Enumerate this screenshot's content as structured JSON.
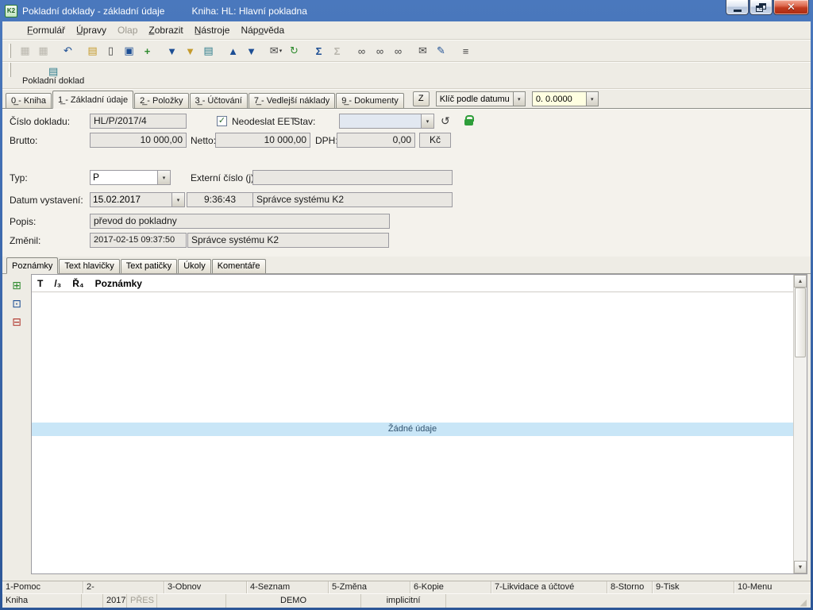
{
  "glyphs": {
    "dropdown": "▾",
    "check": "✓",
    "close": "✕",
    "scroll_up": "▲",
    "scroll_down": "▼",
    "history": "↺",
    "resize": "◢"
  },
  "window": {
    "icon_text": "K2",
    "title": "Pokladní doklady - základní údaje",
    "subtitle": "Kniha: HL: Hlavní pokladna"
  },
  "menu": {
    "items": [
      {
        "label": "F̲ormulář"
      },
      {
        "label": "Ú̲pravy"
      },
      {
        "label": "Olap"
      },
      {
        "label": "Z̲obrazit"
      },
      {
        "label": "N̲ástroje"
      },
      {
        "label": "Nápo̲věda"
      }
    ]
  },
  "toolbar": {
    "buttons": [
      {
        "name": "save",
        "glyph": "▦"
      },
      {
        "name": "save-record",
        "glyph": "▦"
      },
      {
        "name": "undo",
        "glyph": "↶"
      },
      {
        "name": "open",
        "glyph": "▤"
      },
      {
        "name": "new-document",
        "glyph": "▯"
      },
      {
        "name": "copy-document",
        "glyph": "▣"
      },
      {
        "name": "insert-record",
        "glyph": "+"
      },
      {
        "name": "filter",
        "glyph": "▼"
      },
      {
        "name": "filter-settings",
        "glyph": "▼"
      },
      {
        "name": "books",
        "glyph": "▤"
      },
      {
        "name": "previous-record",
        "glyph": "▲"
      },
      {
        "name": "next-record",
        "glyph": "▼"
      },
      {
        "name": "mail-menu",
        "glyph": "✉"
      },
      {
        "name": "actions",
        "glyph": "↻"
      },
      {
        "name": "sum",
        "glyph": "Σ"
      },
      {
        "name": "sum-selection",
        "glyph": "Σ"
      },
      {
        "name": "search",
        "glyph": "∞"
      },
      {
        "name": "search-next",
        "glyph": "∞"
      },
      {
        "name": "search-fulltext",
        "glyph": "∞"
      },
      {
        "name": "send-message",
        "glyph": "✉"
      },
      {
        "name": "edit-text",
        "glyph": "✎"
      },
      {
        "name": "column-settings",
        "glyph": "≡"
      }
    ]
  },
  "toolbar2": {
    "icon_glyph": "▤",
    "label": "Pokladní doklad"
  },
  "tabs": {
    "items": [
      {
        "label": "0̲ - Kniha"
      },
      {
        "label": "1̲ - Základní údaje"
      },
      {
        "label": "2̲ - Položky"
      },
      {
        "label": "3̲ - Účtování"
      },
      {
        "label": "7̲ - Vedlejší náklady"
      },
      {
        "label": "9̲ - Dokumenty"
      }
    ],
    "z_button": "Z",
    "sort_key": "Klíč podle datumu",
    "rate": "0. 0.0000"
  },
  "form": {
    "labels": {
      "doc_number": "Číslo dokladu:",
      "eet": "Neodeslat EET",
      "status": "Stav:",
      "brutto": "Brutto:",
      "netto": "Netto:",
      "dph": "DPH:",
      "type": "Typ:",
      "external": "Externí číslo (j):",
      "issue_date": "Datum vystavení:",
      "description": "Popis:",
      "changed": "Změnil:"
    },
    "values": {
      "doc_number": "HL/P/2017/4",
      "status": "",
      "brutto": "10 000,00",
      "netto": "10 000,00",
      "dph": "0,00",
      "currency": "Kč",
      "type": "P",
      "external": "",
      "issue_date": "15.02.2017",
      "issue_time": "9:36:43",
      "issued_by": "Správce systému K2",
      "description": "převod do pokladny",
      "changed_at": "2017-02-15 09:37:50",
      "changed_by": "Správce systému K2"
    }
  },
  "subtabs": {
    "items": [
      {
        "label": "Poznámky"
      },
      {
        "label": "Text hlavičky"
      },
      {
        "label": "Text patičky"
      },
      {
        "label": "Úkoly"
      },
      {
        "label": "Komentáře"
      }
    ]
  },
  "notes": {
    "side_icons": [
      {
        "name": "insert-note",
        "glyph": "⊞"
      },
      {
        "name": "copy-note",
        "glyph": "⊡"
      },
      {
        "name": "delete-note",
        "glyph": "⊟"
      }
    ],
    "header": {
      "c1": "T",
      "c2": "/₃",
      "c3": "Ř₄",
      "c4": "Poznámky"
    },
    "empty_text": "Žádné údaje"
  },
  "fkeys": {
    "items": [
      {
        "label": "1-Pomoc"
      },
      {
        "label": "2-"
      },
      {
        "label": "3-Obnov"
      },
      {
        "label": "4-Seznam"
      },
      {
        "label": "5-Změna"
      },
      {
        "label": "6-Kopie"
      },
      {
        "label": "7-Likvidace a účtové"
      },
      {
        "label": "8-Storno"
      },
      {
        "label": "9-Tisk"
      },
      {
        "label": "10-Menu"
      }
    ]
  },
  "status": {
    "book": "Kniha",
    "year": "2017",
    "mode": "PŘES",
    "company": "DEMO",
    "profile": "implicitní"
  }
}
